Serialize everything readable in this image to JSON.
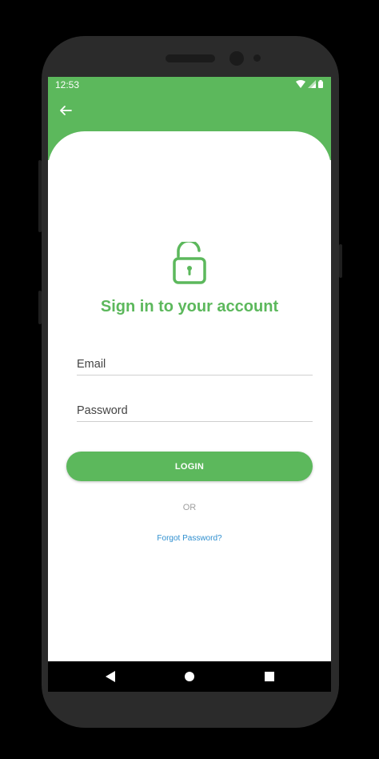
{
  "status_bar": {
    "time": "12:53",
    "icons": [
      "wifi-icon",
      "signal-icon",
      "battery-icon"
    ]
  },
  "app_bar": {
    "back_icon": "arrow-left-icon"
  },
  "login": {
    "lock_icon": "unlocked-padlock-icon",
    "title": "Sign in to your account",
    "email_placeholder": "Email",
    "password_placeholder": "Password",
    "login_label": "LOGIN",
    "or_label": "OR",
    "forgot_label": "Forgot Password?"
  },
  "nav_bar": {
    "icons": [
      "nav-back-icon",
      "nav-home-icon",
      "nav-recent-icon"
    ]
  },
  "colors": {
    "accent": "#5cb85c",
    "link": "#2f8fcf",
    "muted": "#9e9e9e"
  }
}
